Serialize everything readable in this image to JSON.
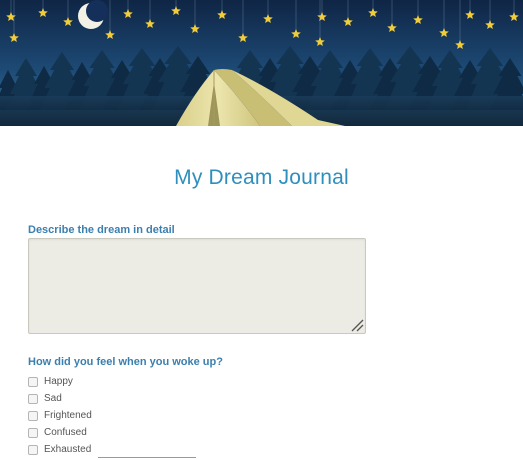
{
  "page": {
    "title": "My Dream Journal"
  },
  "header": {
    "scene": "night-camping-illustration",
    "icons": [
      "moon-icon",
      "star-icon",
      "tent-icon",
      "pine-tree-icon"
    ]
  },
  "form": {
    "dream_description": {
      "label": "Describe the dream in detail",
      "value": "",
      "placeholder": ""
    },
    "feelings": {
      "label": "How did you feel when you woke up?",
      "options": [
        {
          "label": "Happy",
          "checked": false
        },
        {
          "label": "Sad",
          "checked": false
        },
        {
          "label": "Frightened",
          "checked": false
        },
        {
          "label": "Confused",
          "checked": false
        },
        {
          "label": "Exhausted",
          "checked": false
        }
      ]
    }
  },
  "colors": {
    "title": "#2e8fbd",
    "label": "#3b7fae",
    "sky_top": "#11284a",
    "sky_bottom": "#2f6f96",
    "tent": "#e4dc9a",
    "star": "#f2cd3b",
    "textarea_bg": "#ecece4"
  }
}
